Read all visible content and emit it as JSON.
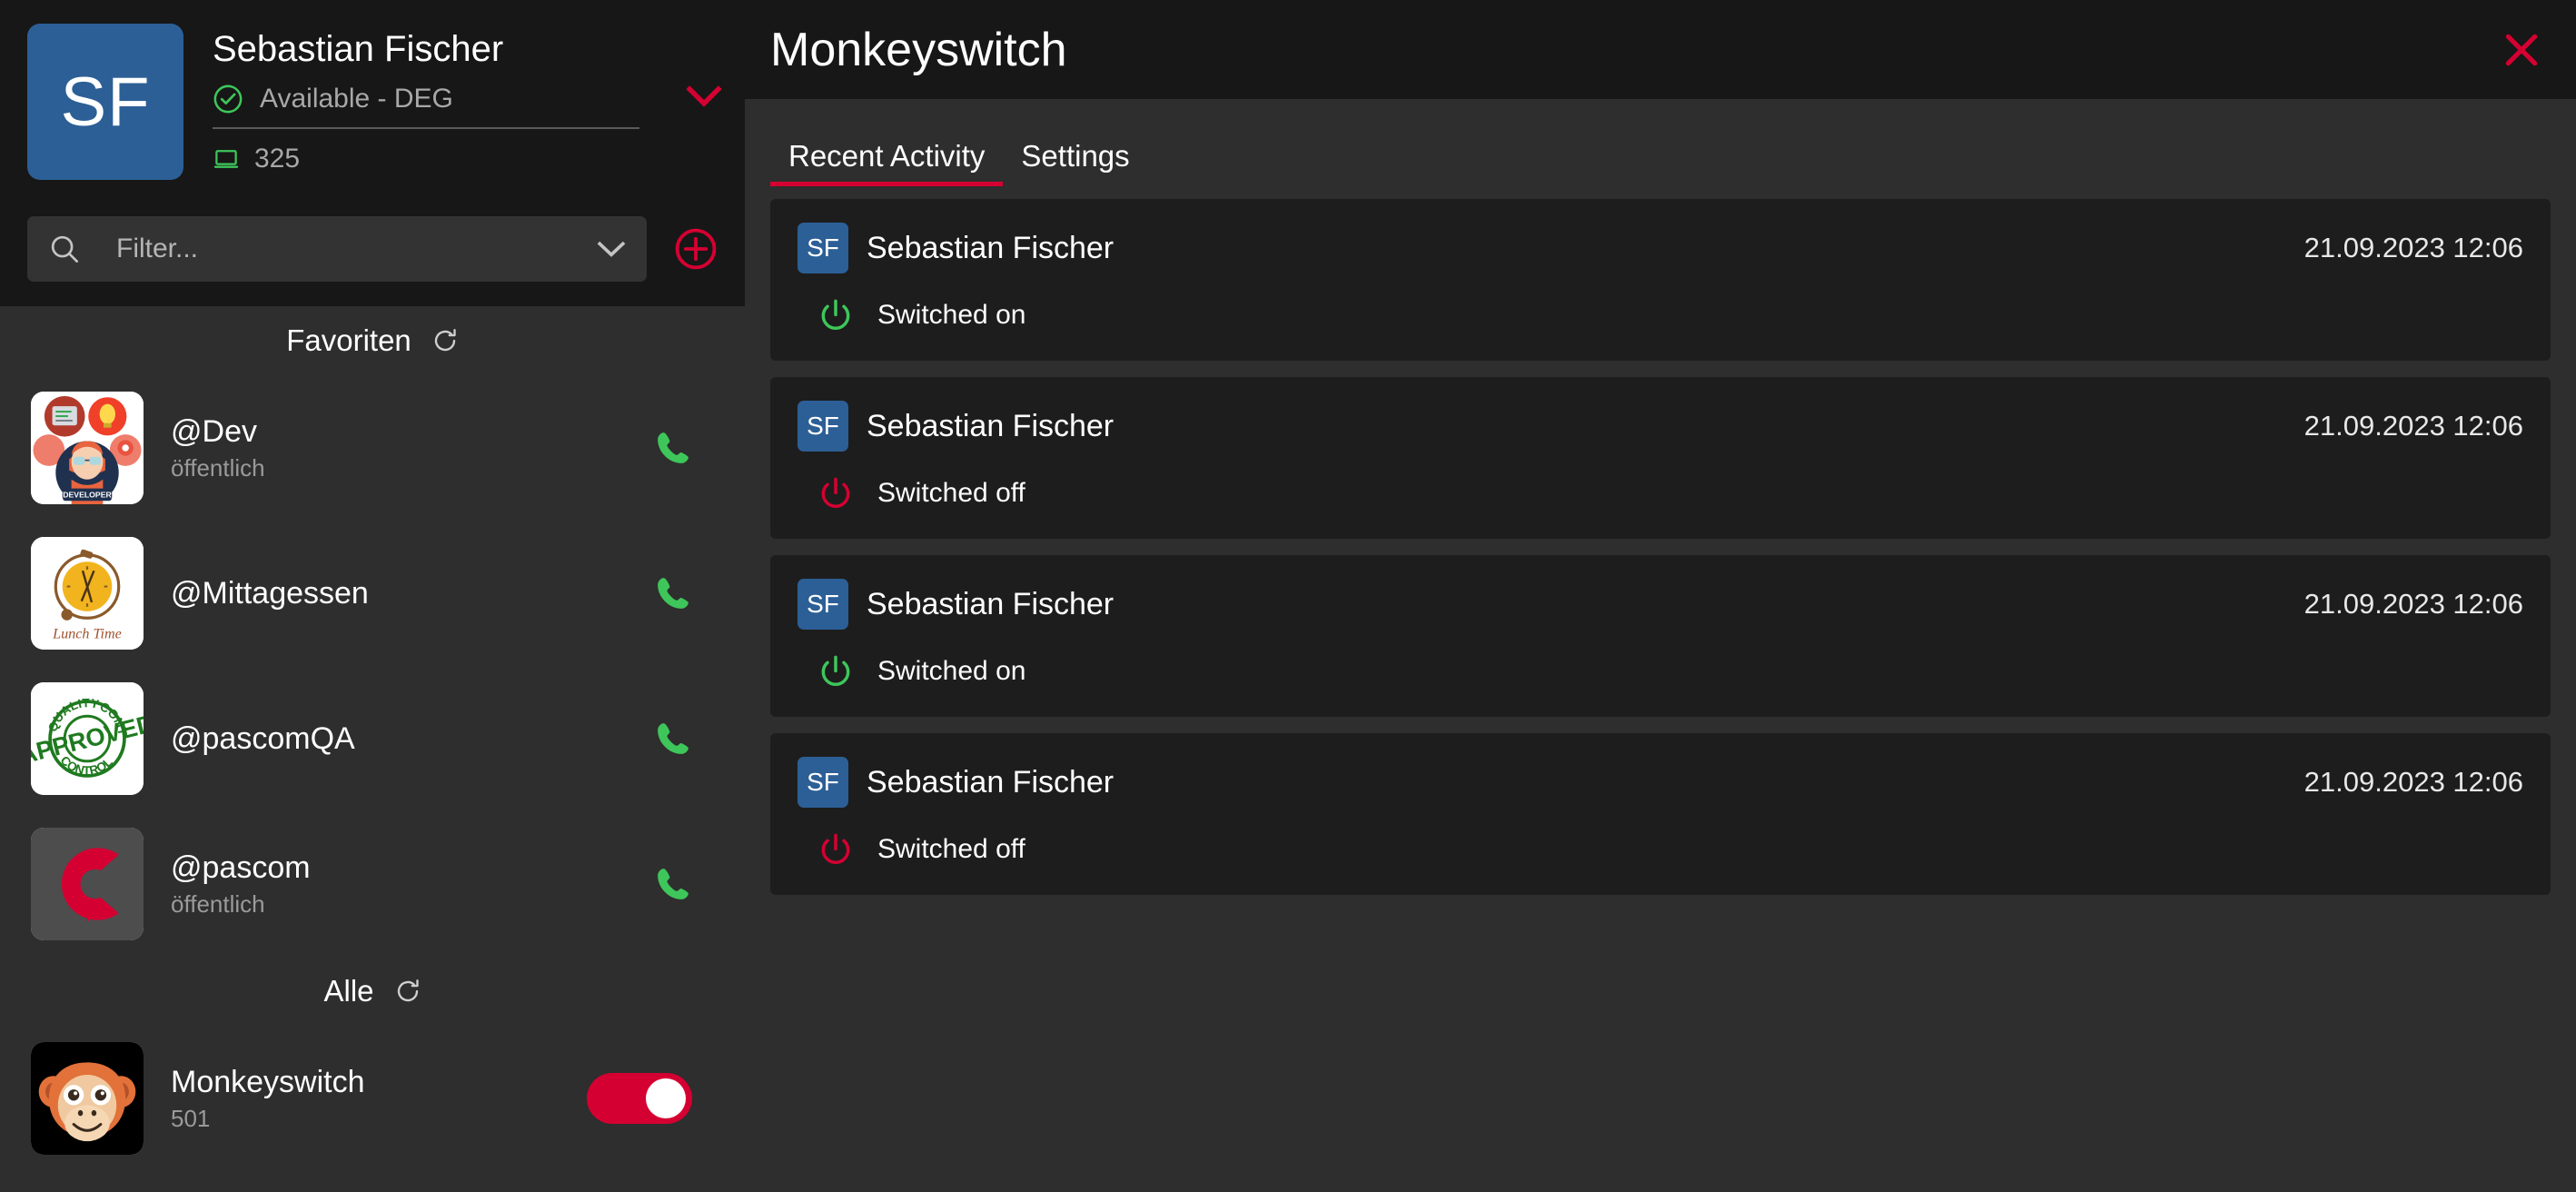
{
  "profile": {
    "initials": "SF",
    "name": "Sebastian Fischer",
    "status_text": "Available - DEG",
    "status_icon": "check-circle-icon",
    "extension": "325",
    "extension_icon": "desktop-icon",
    "expand_icon": "chevron-down-icon"
  },
  "filter": {
    "placeholder": "Filter...",
    "value": "",
    "search_icon": "search-icon",
    "dropdown_icon": "chevron-down-icon",
    "add_icon": "plus-circle-icon"
  },
  "groups": [
    {
      "title": "Favoriten",
      "refresh_icon": "refresh-icon",
      "items": [
        {
          "name": "@Dev",
          "sub": "öffentlich",
          "action": "call",
          "avatar": "developer-illustration"
        },
        {
          "name": "@Mittagessen",
          "sub": "",
          "action": "call",
          "avatar": "lunch-time-clock"
        },
        {
          "name": "@pascomQA",
          "sub": "",
          "action": "call",
          "avatar": "quality-approved-stamp"
        },
        {
          "name": "@pascom",
          "sub": "öffentlich",
          "action": "call",
          "avatar": "pascom-logo"
        }
      ]
    },
    {
      "title": "Alle",
      "refresh_icon": "refresh-icon",
      "items": [
        {
          "name": "Monkeyswitch",
          "sub": "501",
          "action": "toggle",
          "toggle_on": true,
          "avatar": "monkey-face"
        }
      ]
    }
  ],
  "main": {
    "title": "Monkeyswitch",
    "close_icon": "close-icon",
    "tabs": [
      {
        "label": "Recent Activity",
        "active": true
      },
      {
        "label": "Settings",
        "active": false
      }
    ],
    "activities": [
      {
        "initials": "SF",
        "user": "Sebastian Fischer",
        "time": "21.09.2023 12:06",
        "status": "Switched on",
        "state": "on"
      },
      {
        "initials": "SF",
        "user": "Sebastian Fischer",
        "time": "21.09.2023 12:06",
        "status": "Switched off",
        "state": "off"
      },
      {
        "initials": "SF",
        "user": "Sebastian Fischer",
        "time": "21.09.2023 12:06",
        "status": "Switched on",
        "state": "on"
      },
      {
        "initials": "SF",
        "user": "Sebastian Fischer",
        "time": "21.09.2023 12:06",
        "status": "Switched off",
        "state": "off"
      }
    ]
  },
  "colors": {
    "accent_red": "#d50032",
    "online_green": "#3ec65a",
    "avatar_blue": "#2c5f96"
  }
}
